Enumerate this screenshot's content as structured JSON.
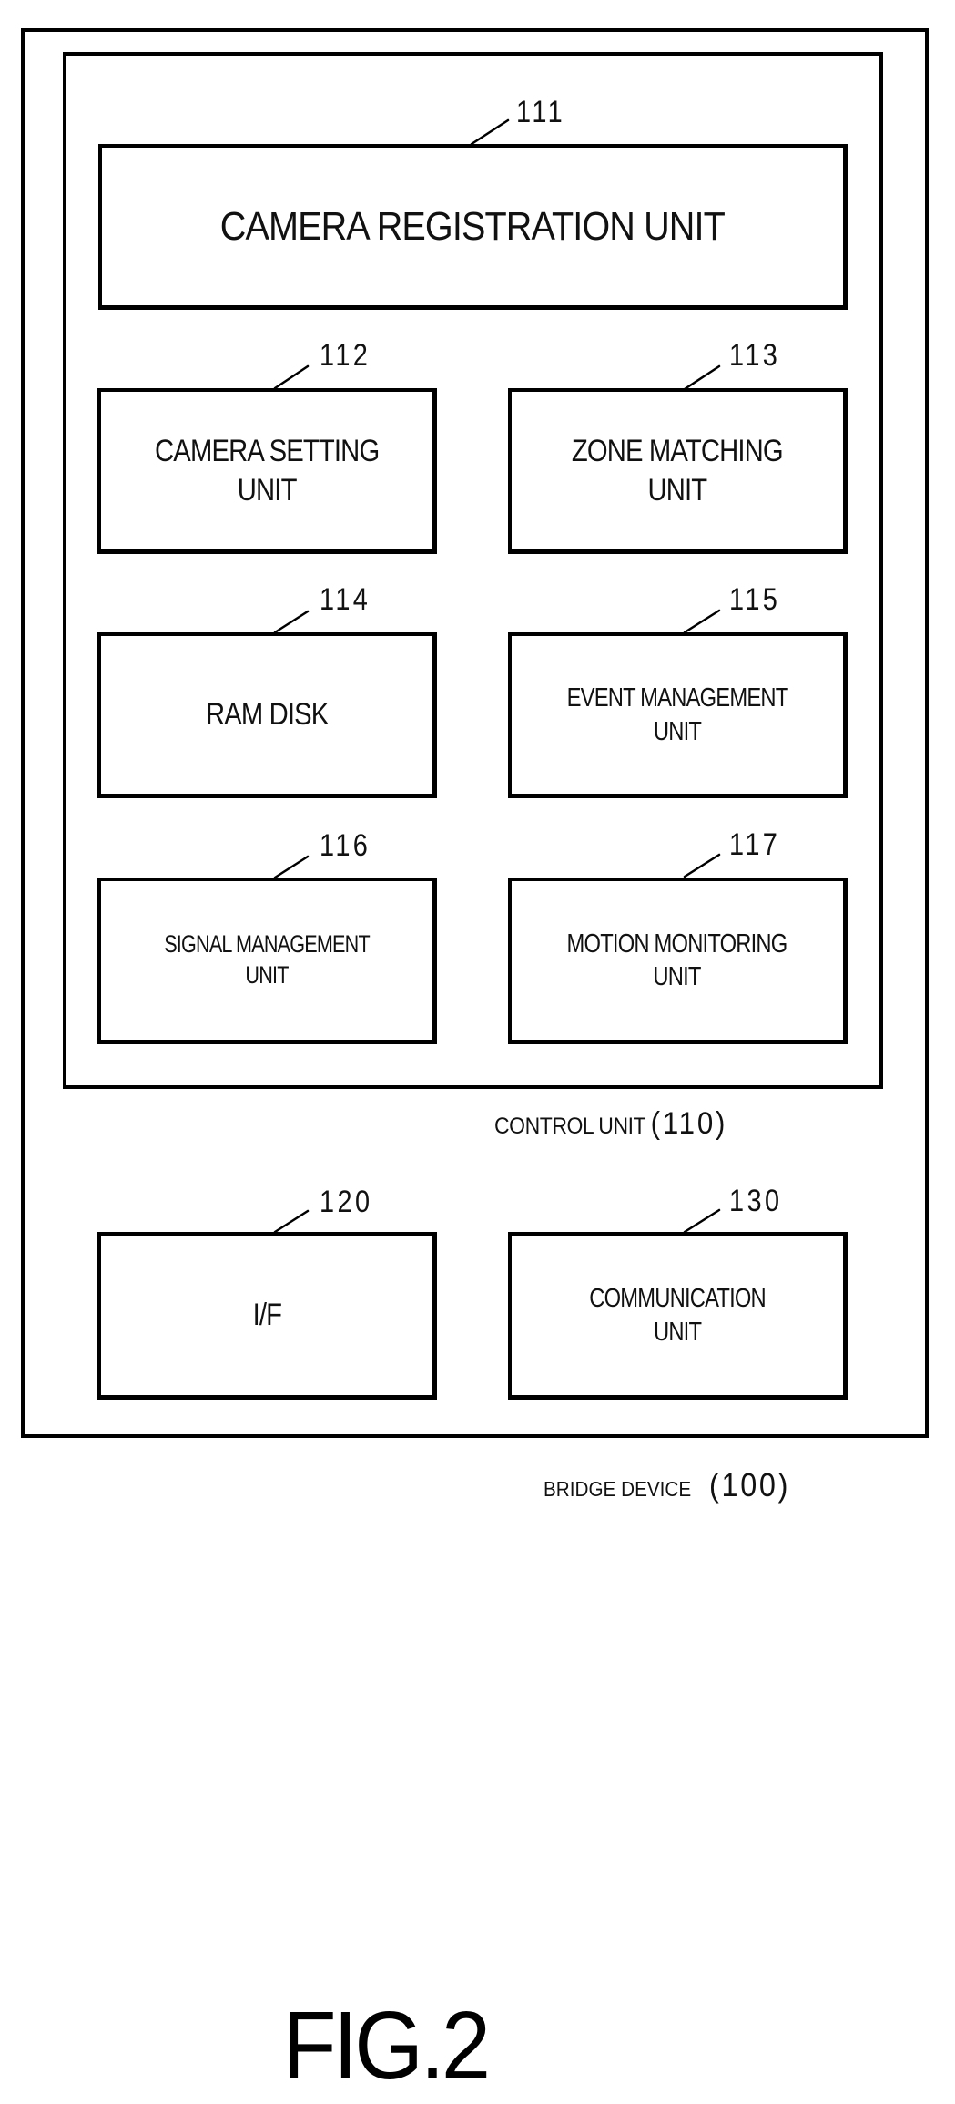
{
  "figure": {
    "label": "FIG.2"
  },
  "bridge_device": {
    "name": "BRIDGE DEVICE",
    "ref": "(100)"
  },
  "control_unit": {
    "name": "CONTROL UNIT",
    "ref": "(110)",
    "units": {
      "camera_registration": {
        "ref": "111",
        "label": "CAMERA REGISTRATION UNIT"
      },
      "camera_setting": {
        "ref": "112",
        "label": "CAMERA SETTING\nUNIT"
      },
      "zone_matching": {
        "ref": "113",
        "label": "ZONE MATCHING\nUNIT"
      },
      "ram_disk": {
        "ref": "114",
        "label": "RAM DISK"
      },
      "event_management": {
        "ref": "115",
        "label": "EVENT MANAGEMENT\nUNIT"
      },
      "signal_management": {
        "ref": "116",
        "label": "SIGNAL MANAGEMENT\nUNIT"
      },
      "motion_monitoring": {
        "ref": "117",
        "label": "MOTION MONITORING\nUNIT"
      }
    }
  },
  "peripheral_units": {
    "interface": {
      "ref": "120",
      "label": "I/F"
    },
    "communication": {
      "ref": "130",
      "label": "COMMUNICATION\nUNIT"
    }
  }
}
